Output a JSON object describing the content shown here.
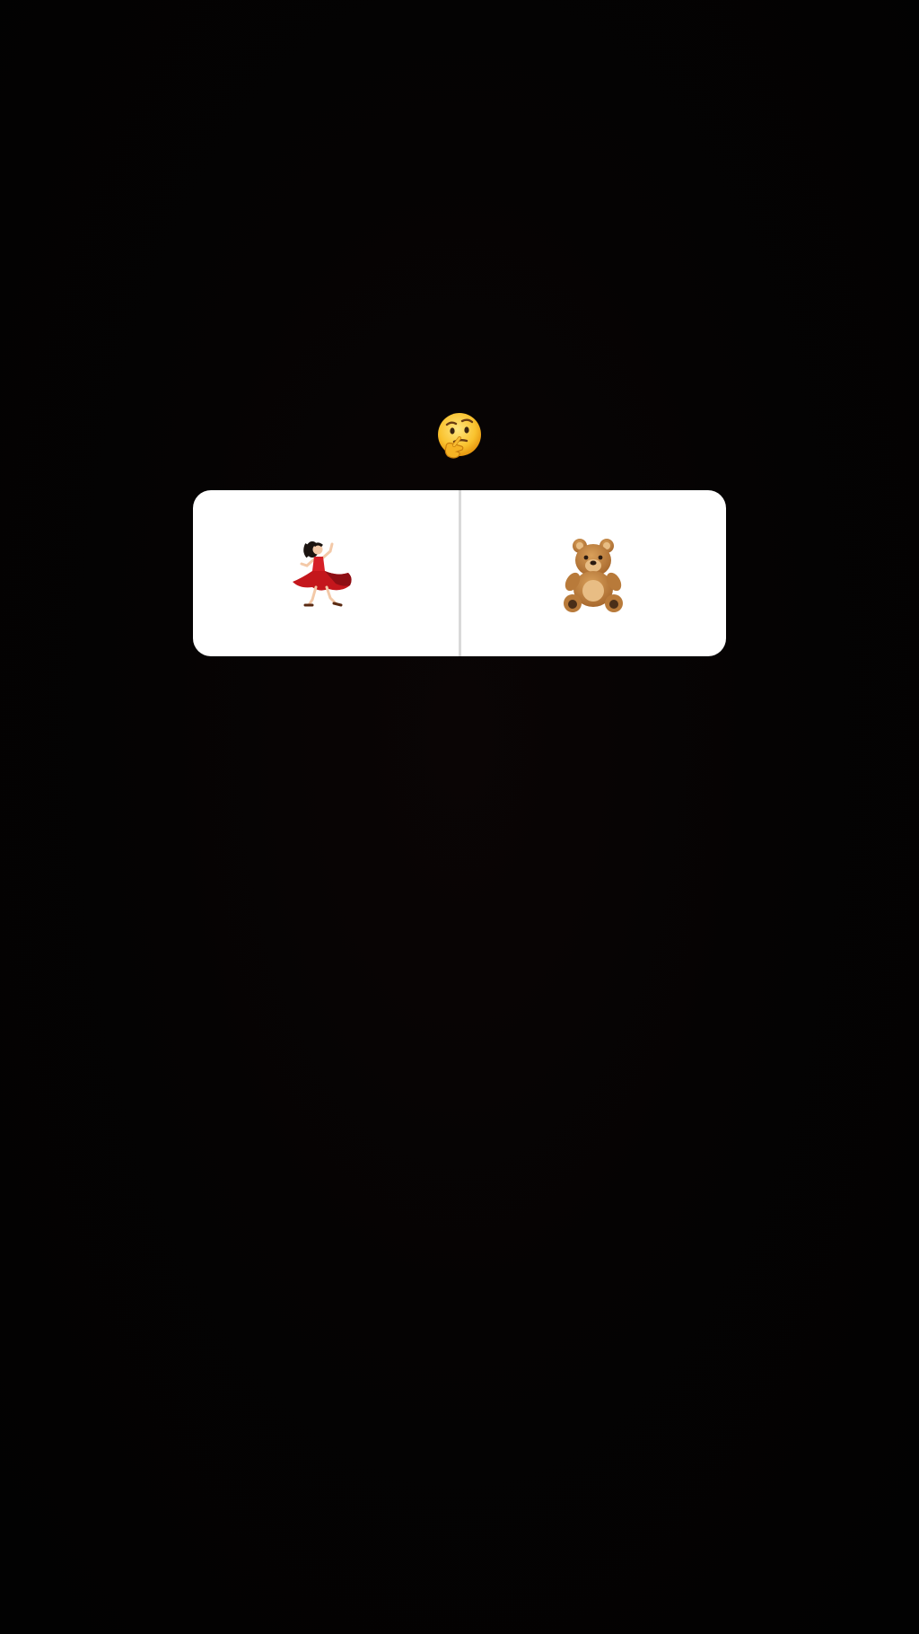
{
  "story": {
    "question": {
      "icon": "thinking-face-icon"
    },
    "poll": {
      "options": [
        {
          "icon": "woman-dancing-icon"
        },
        {
          "icon": "teddy-bear-icon"
        }
      ]
    }
  },
  "colors": {
    "background": "#040303",
    "card": "#ffffff",
    "divider": "#d9d9d9"
  }
}
